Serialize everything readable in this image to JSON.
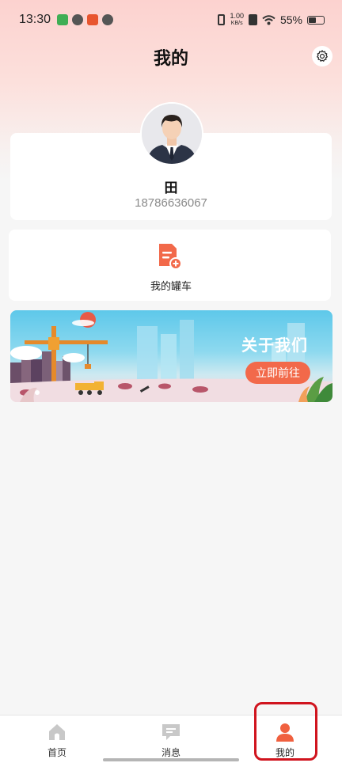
{
  "status_bar": {
    "time": "13:30",
    "speed_value": "1.00",
    "speed_unit": "KB/s",
    "battery": "55%",
    "battery_level": 0.55
  },
  "header": {
    "title": "我的",
    "settings_icon": "gear-icon"
  },
  "profile": {
    "name": "田",
    "phone": "18786636067"
  },
  "tank": {
    "label": "我的罐车",
    "icon": "document-add-icon"
  },
  "banner": {
    "title": "关于我们",
    "button_label": "立即前往"
  },
  "tabs": [
    {
      "label": "首页",
      "icon": "home-icon",
      "active": false
    },
    {
      "label": "消息",
      "icon": "message-icon",
      "active": false
    },
    {
      "label": "我的",
      "icon": "person-icon",
      "active": true
    }
  ],
  "colors": {
    "accent": "#f2694a",
    "tab_active": "#f0603f",
    "tab_inactive": "#c8c8c8",
    "highlight_box": "#d0141e"
  }
}
